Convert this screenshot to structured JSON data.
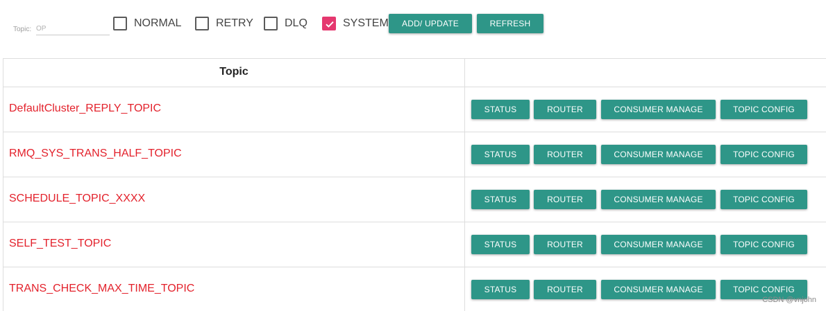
{
  "toolbar": {
    "topic_filter": {
      "label": "Topic:",
      "placeholder": "OP",
      "value": ""
    },
    "checkboxes": [
      {
        "label": "NORMAL",
        "checked": false
      },
      {
        "label": "RETRY",
        "checked": false
      },
      {
        "label": "DLQ",
        "checked": false
      },
      {
        "label": "SYSTEM",
        "checked": true
      }
    ],
    "add_update_label": "ADD/ UPDATE",
    "refresh_label": "REFRESH"
  },
  "table": {
    "header": {
      "topic": "Topic",
      "operation": ""
    },
    "action_labels": {
      "status": "STATUS",
      "router": "ROUTER",
      "consumer_manage": "CONSUMER MANAGE",
      "topic_config": "TOPIC CONFIG"
    },
    "rows": [
      {
        "topic": "DefaultCluster_REPLY_TOPIC"
      },
      {
        "topic": "RMQ_SYS_TRANS_HALF_TOPIC"
      },
      {
        "topic": "SCHEDULE_TOPIC_XXXX"
      },
      {
        "topic": "SELF_TEST_TOPIC"
      },
      {
        "topic": "TRANS_CHECK_MAX_TIME_TOPIC"
      }
    ]
  },
  "colors": {
    "accent": "#2e9688",
    "checkbox_checked": "#e5386f",
    "topic_link": "#e3212b"
  },
  "icons": {
    "checkmark": "check-icon"
  },
  "watermark": "CSDN @vnjohn"
}
